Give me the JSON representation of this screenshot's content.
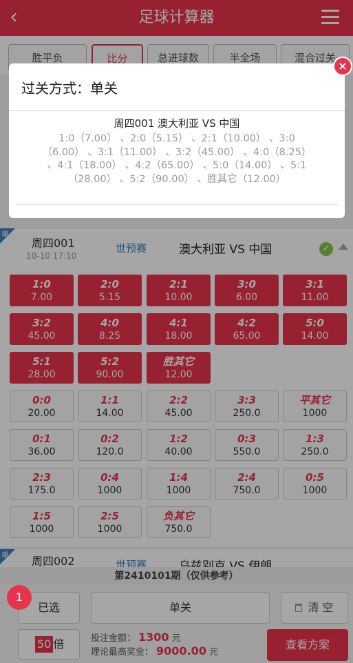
{
  "header": {
    "back_glyph": "‹",
    "title": "足球计算器"
  },
  "tabs": [
    "胜平负",
    "比分",
    "总进球数",
    "半全场",
    "混合过关"
  ],
  "match1": {
    "badge": "单",
    "number": "周四001",
    "time": "10-10 17:10",
    "league": "世预赛",
    "teams": "澳大利亚  VS  中国"
  },
  "scores": [
    {
      "s": "1:0",
      "o": "7.00",
      "sel": true
    },
    {
      "s": "2:0",
      "o": "5.15",
      "sel": true
    },
    {
      "s": "2:1",
      "o": "10.00",
      "sel": true
    },
    {
      "s": "3:0",
      "o": "6.00",
      "sel": true
    },
    {
      "s": "3:1",
      "o": "11.00",
      "sel": true
    },
    {
      "s": "3:2",
      "o": "45.00",
      "sel": true
    },
    {
      "s": "4:0",
      "o": "8.25",
      "sel": true
    },
    {
      "s": "4:1",
      "o": "18.00",
      "sel": true
    },
    {
      "s": "4:2",
      "o": "65.00",
      "sel": true
    },
    {
      "s": "5:0",
      "o": "14.00",
      "sel": true
    },
    {
      "s": "5:1",
      "o": "28.00",
      "sel": true
    },
    {
      "s": "5:2",
      "o": "90.00",
      "sel": true
    },
    {
      "s": "胜其它",
      "o": "12.00",
      "sel": true
    },
    {
      "s": "0:0",
      "o": "20.00",
      "sel": false
    },
    {
      "s": "1:1",
      "o": "14.00",
      "sel": false
    },
    {
      "s": "2:2",
      "o": "45.00",
      "sel": false
    },
    {
      "s": "3:3",
      "o": "250.0",
      "sel": false
    },
    {
      "s": "平其它",
      "o": "1000",
      "sel": false
    },
    {
      "s": "0:1",
      "o": "36.00",
      "sel": false
    },
    {
      "s": "0:2",
      "o": "120.0",
      "sel": false
    },
    {
      "s": "1:2",
      "o": "40.00",
      "sel": false
    },
    {
      "s": "0:3",
      "o": "550.0",
      "sel": false
    },
    {
      "s": "1:3",
      "o": "250.0",
      "sel": false
    },
    {
      "s": "2:3",
      "o": "175.0",
      "sel": false
    },
    {
      "s": "0:4",
      "o": "1000",
      "sel": false
    },
    {
      "s": "1:4",
      "o": "1000",
      "sel": false
    },
    {
      "s": "2:4",
      "o": "750.0",
      "sel": false
    },
    {
      "s": "0:5",
      "o": "1000",
      "sel": false
    },
    {
      "s": "1:5",
      "o": "1000",
      "sel": false
    },
    {
      "s": "2:5",
      "o": "1000",
      "sel": false
    },
    {
      "s": "负其它",
      "o": "750.0",
      "sel": false
    }
  ],
  "match2": {
    "badge": "单",
    "number": "周四002",
    "league": "世预赛",
    "teams": "乌兹别克  VS  伊朗"
  },
  "period": "第2410101期（仅供参考）",
  "bottom": {
    "selected_count": "1",
    "selected_label": "已选",
    "mode_label": "单关",
    "clear_label": "清 空",
    "multiplier": "50",
    "multiplier_unit": "倍",
    "bet_label": "投注金额：",
    "bet_value": "1300",
    "bet_unit": "元",
    "max_label": "理论最高奖金：",
    "max_value": "9000.00",
    "max_unit": "元",
    "view_label": "查看方案"
  },
  "modal": {
    "title": "过关方式：单关",
    "match": "周四001 澳大利亚 VS 中国",
    "options": "1:0（7.00） 、2:0（5.15） 、2:1（10.00） 、3:0（6.00） 、3:1（11.00） 、3:2（45.00） 、4:0（8.25） 、4:1（18.00） 、4:2（65.00） 、5:0（14.00） 、5:1（28.00） 、5:2（90.00） 、胜其它（12.00）",
    "close_glyph": "×"
  },
  "colors": {
    "accent": "#e8334c",
    "league": "#3b7fc4",
    "check": "#8bc34a"
  }
}
